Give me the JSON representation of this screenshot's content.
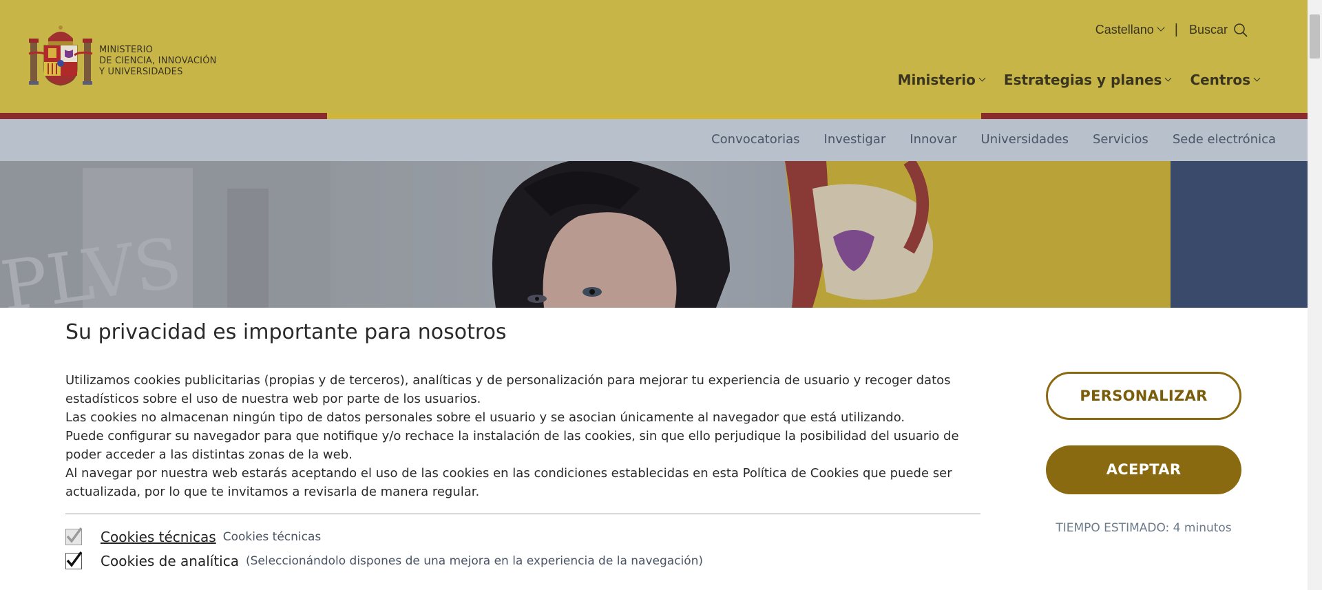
{
  "header": {
    "ministry_lines": [
      "MINISTERIO",
      "DE CIENCIA, INNOVACIÓN",
      "Y UNIVERSIDADES"
    ],
    "language": "Castellano",
    "separator": "|",
    "search_label": "Buscar",
    "main_nav": [
      {
        "label": "Ministerio"
      },
      {
        "label": "Estrategias y planes"
      },
      {
        "label": "Centros"
      }
    ],
    "sub_nav": [
      {
        "label": "Convocatorias"
      },
      {
        "label": "Investigar"
      },
      {
        "label": "Innovar"
      },
      {
        "label": "Universidades"
      },
      {
        "label": "Servicios"
      },
      {
        "label": "Sede electrónica"
      }
    ]
  },
  "hero": {
    "wall_text": "PLVS"
  },
  "cookie_banner": {
    "title": "Su privacidad es importante para nosotros",
    "paragraphs": [
      "Utilizamos cookies publicitarias (propias y de terceros), analíticas y de personalización para mejorar tu experiencia de usuario y recoger datos estadísticos sobre el uso de nuestra web por parte de los usuarios.",
      "Las cookies no almacenan ningún tipo de datos personales sobre el usuario y se asocian únicamente al navegador que está utilizando.",
      "Puede configurar su navegador para que notifique y/o rechace la instalación de las cookies, sin que ello perjudique la posibilidad del usuario de poder acceder a las distintas zonas de la web.",
      "Al navegar por nuestra web estarás aceptando el uso de las cookies en las condiciones establecidas en esta Política de Cookies que puede ser actualizada, por lo que te invitamos a revisarla de manera regular."
    ],
    "options": [
      {
        "title": "Cookies técnicas",
        "desc": "Cookies técnicas",
        "checked": true,
        "disabled": true
      },
      {
        "title": "Cookies de analítica",
        "desc": "(Seleccionándolo dispones de una mejora en la experiencia de la navegación)",
        "checked": true,
        "disabled": false
      }
    ],
    "personalize_label": "PERSONALIZAR",
    "accept_label": "ACEPTAR",
    "time_label": "TIEMPO ESTIMADO: 4 minutos"
  },
  "colors": {
    "header_bg": "#c8b548",
    "subnav_bg": "#b8c0cc",
    "accent_gold": "#8a6a10",
    "stripe_red": "#8a2a2a"
  }
}
